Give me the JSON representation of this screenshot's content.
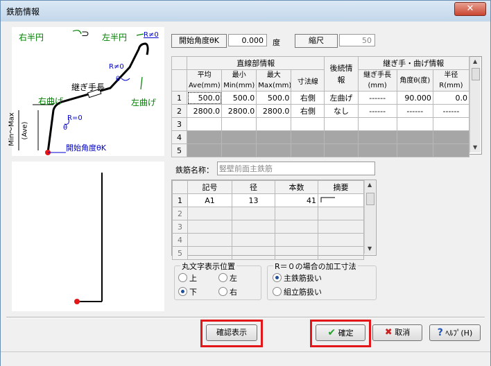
{
  "window": {
    "title": "鉄筋情報",
    "close_glyph": "✕"
  },
  "diagram": {
    "right_half_circle": "右半円",
    "left_half_circle": "左半円",
    "r_ne0_top": "R≠0",
    "r_ne0_mid": "R≠0",
    "joint_length": "継ぎ手長",
    "theta1": "θ",
    "theta2": "θ",
    "right_bend": "右曲げ",
    "left_bend": "左曲げ",
    "r_eq0": "R=0",
    "min_max": "Min～Max",
    "ave": "(Ave)",
    "start_angle": "開始角度θK"
  },
  "top_fields": {
    "start_angle_label": "開始角度θK",
    "start_angle_value": "0.000",
    "start_angle_unit": "度",
    "scale_label": "縮尺",
    "scale_value": "50"
  },
  "main_table": {
    "group_straight": "直線部情報",
    "group_follow": "後続情報",
    "group_joint": "継ぎ手・曲げ情報",
    "headers": [
      "平均Ave(mm)",
      "最小Min(mm)",
      "最大Max(mm)",
      "寸法線",
      "継ぎ手長(mm)",
      "角度θ(度)",
      "半径R(mm)"
    ],
    "rows": [
      {
        "no": "1",
        "ave": "500.0",
        "min": "500.0",
        "max": "500.0",
        "dim": "右側",
        "follow": "左曲げ",
        "joint": "------",
        "angle": "90.000",
        "radius": "0.0"
      },
      {
        "no": "2",
        "ave": "2800.0",
        "min": "2800.0",
        "max": "2800.0",
        "dim": "右側",
        "follow": "なし",
        "joint": "------",
        "angle": "------",
        "radius": "------"
      },
      {
        "no": "3"
      },
      {
        "no": "4"
      },
      {
        "no": "5"
      }
    ]
  },
  "rebar_name": {
    "label": "鉄筋名称：",
    "value": "竪壁前面主鉄筋"
  },
  "sub_table": {
    "headers": [
      "記号",
      "径",
      "本数",
      "摘要"
    ],
    "rows": [
      {
        "no": "1",
        "sym": "A1",
        "dia": "13",
        "count": "41"
      },
      {
        "no": "2"
      },
      {
        "no": "3"
      },
      {
        "no": "4"
      },
      {
        "no": "5"
      }
    ]
  },
  "circle_position": {
    "title": "丸文字表示位置",
    "options": [
      "上",
      "左",
      "下",
      "右"
    ],
    "selected": "下"
  },
  "processing": {
    "title": "R＝０の場合の加工寸法",
    "options": [
      "主鉄筋扱い",
      "組立筋扱い"
    ],
    "selected": "主鉄筋扱い"
  },
  "buttons": {
    "confirm_display": "確認表示",
    "ok": "確定",
    "cancel": "取消",
    "help": "ﾍﾙﾌﾟ(H)"
  },
  "colors": {
    "green": "#008000",
    "blue": "#0000cc",
    "red": "#e3161a"
  }
}
